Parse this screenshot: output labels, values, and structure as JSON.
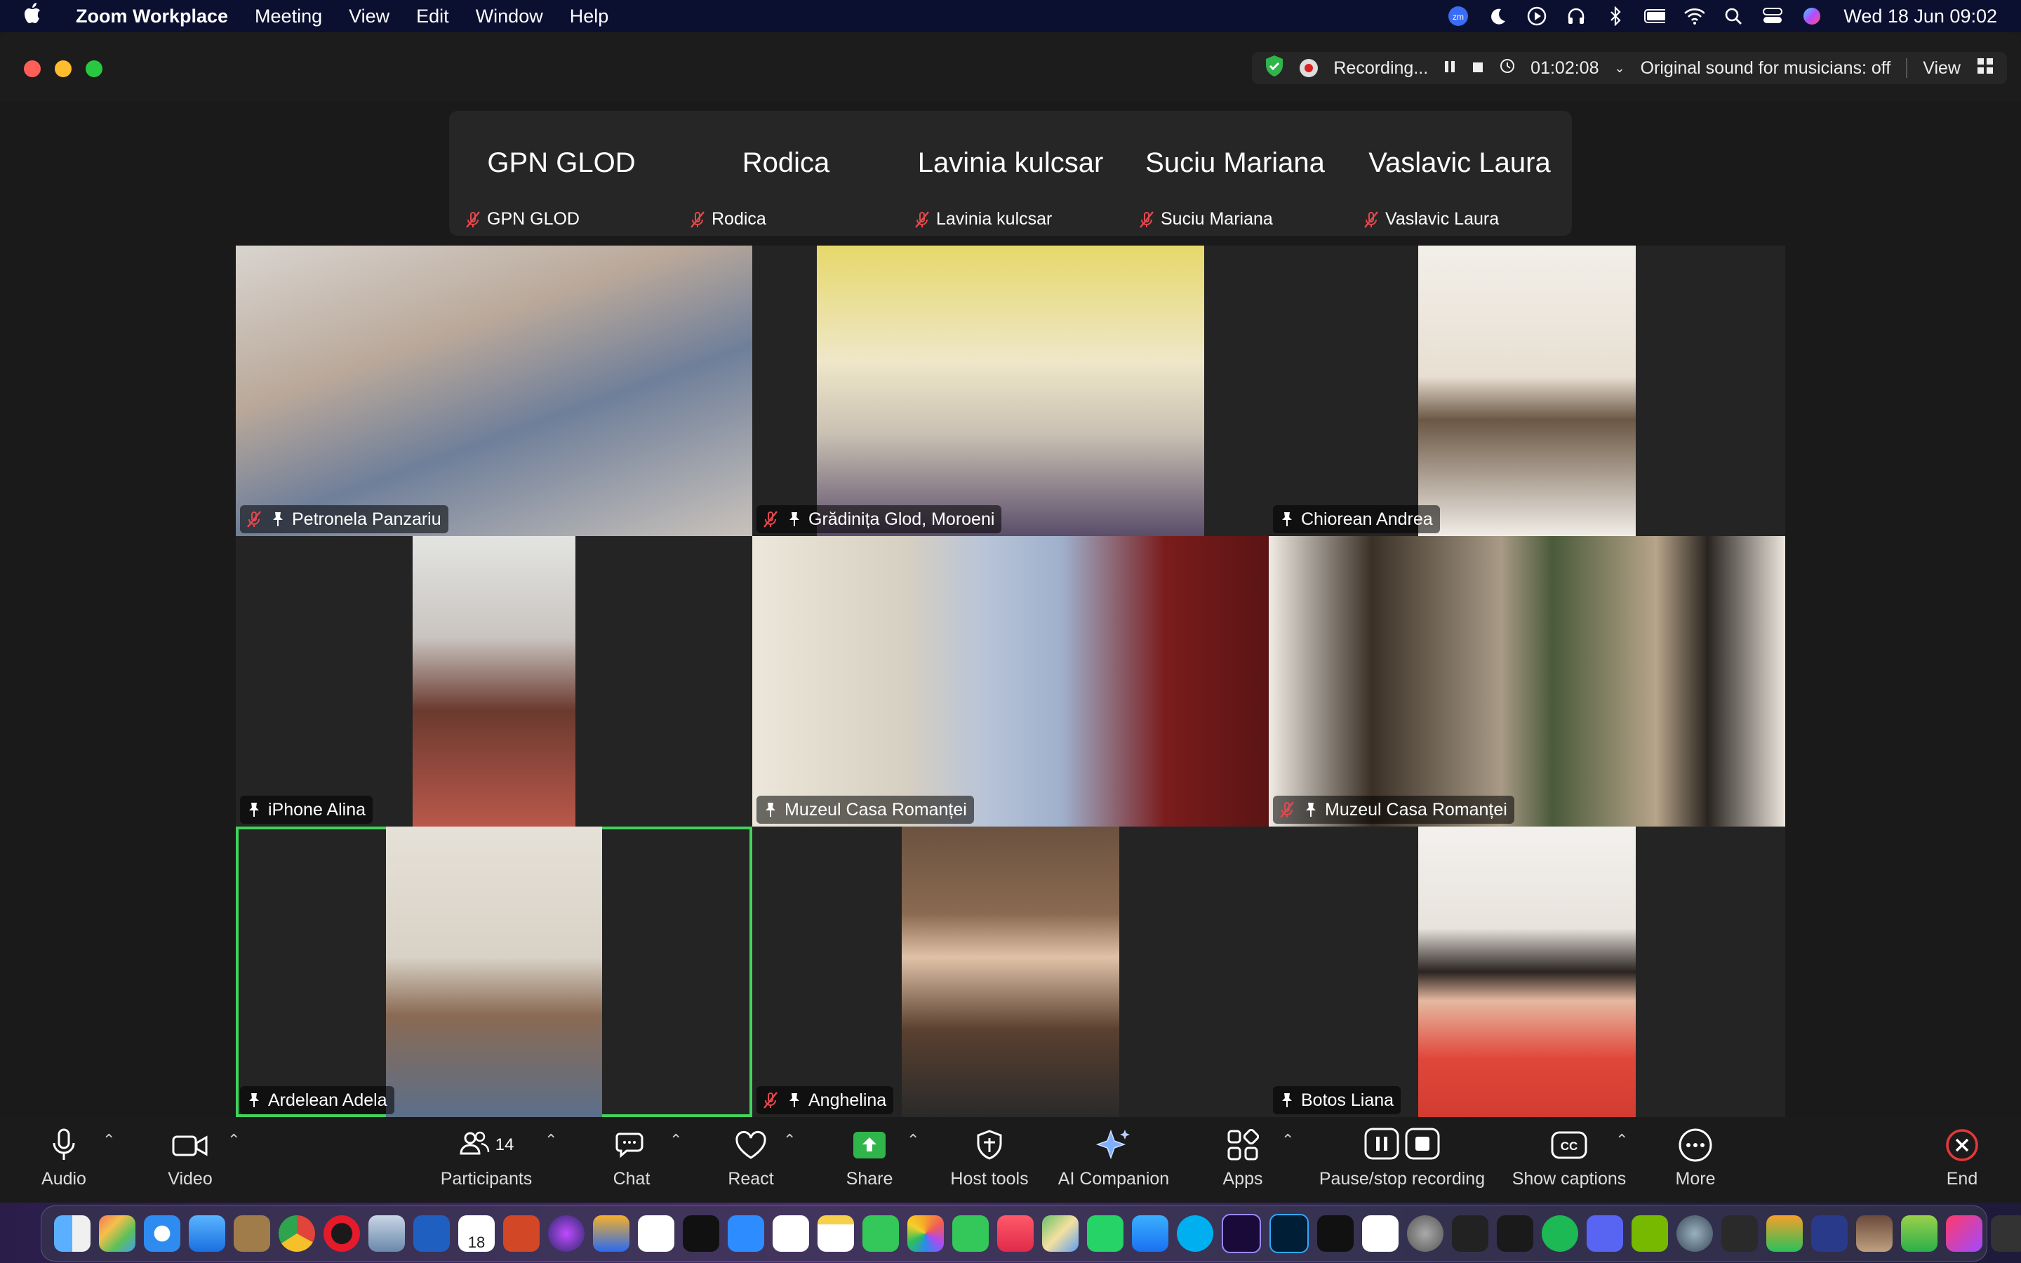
{
  "menubar": {
    "app_name": "Zoom Workplace",
    "menus": [
      "Meeting",
      "View",
      "Edit",
      "Window",
      "Help"
    ],
    "clock": "Wed 18 Jun  09:02",
    "status_icons": [
      "zoom-icon",
      "moon-icon",
      "play-circle-icon",
      "headphones-icon",
      "bluetooth-icon",
      "battery-icon",
      "wifi-icon",
      "search-icon",
      "control-center-icon",
      "siri-icon"
    ]
  },
  "window": {
    "recording_label": "Recording...",
    "timer": "01:02:08",
    "original_sound": "Original sound for musicians: off",
    "view_label": "View"
  },
  "strip": [
    {
      "big": "GPN GLOD",
      "small": "GPN GLOD"
    },
    {
      "big": "Rodica",
      "small": "Rodica"
    },
    {
      "big": "Lavinia kulcsar",
      "small": "Lavinia kulcsar"
    },
    {
      "big": "Suciu Mariana",
      "small": "Suciu Mariana"
    },
    {
      "big": "Vaslavic Laura",
      "small": "Vaslavic Laura"
    }
  ],
  "tiles": [
    {
      "name": "Petronela Panzariu",
      "muted": true
    },
    {
      "name": "Grădinița Glod, Moroeni",
      "muted": true
    },
    {
      "name": "Chiorean Andrea",
      "muted": false
    },
    {
      "name": "iPhone Alina",
      "muted": false
    },
    {
      "name": "Muzeul Casa Romanței",
      "muted": false
    },
    {
      "name": "Muzeul Casa Romanței",
      "muted": true
    },
    {
      "name": "Ardelean Adela",
      "muted": false,
      "active": true
    },
    {
      "name": "Anghelina",
      "muted": true
    },
    {
      "name": "Botos Liana",
      "muted": false
    }
  ],
  "toolbar": {
    "audio": "Audio",
    "video": "Video",
    "participants": "Participants",
    "participants_count": "14",
    "chat": "Chat",
    "react": "React",
    "share": "Share",
    "host_tools": "Host tools",
    "ai_companion": "AI Companion",
    "apps": "Apps",
    "pause_stop": "Pause/stop recording",
    "show_captions": "Show captions",
    "more": "More",
    "end": "End"
  },
  "dock": {
    "apps": [
      "finder",
      "launchpad",
      "safari",
      "mail",
      "contacts",
      "chrome",
      "opera",
      "preview",
      "word",
      "calendar",
      "powerpoint",
      "siri",
      "keynote",
      "freeform",
      "apple-tv",
      "zoom",
      "reminders",
      "notes",
      "facetime",
      "photos",
      "messages",
      "music",
      "maps",
      "whatsapp",
      "app-store",
      "skype",
      "premiere",
      "photoshop",
      "tiktok",
      "capcut",
      "settings",
      "vectorworks",
      "nvidia",
      "spotify",
      "discord",
      "geforce",
      "quicktime",
      "calculator",
      "home",
      "meet",
      "photo-booth",
      "icloud",
      "creative-cloud",
      "display",
      "trash"
    ],
    "calendar_day": "18"
  },
  "colors": {
    "menubar_bg": "#0b1030",
    "active_speaker_border": "#3fd45b",
    "share_green": "#2fb54a",
    "end_red": "#e5383b",
    "muted_red": "#e5484d"
  }
}
